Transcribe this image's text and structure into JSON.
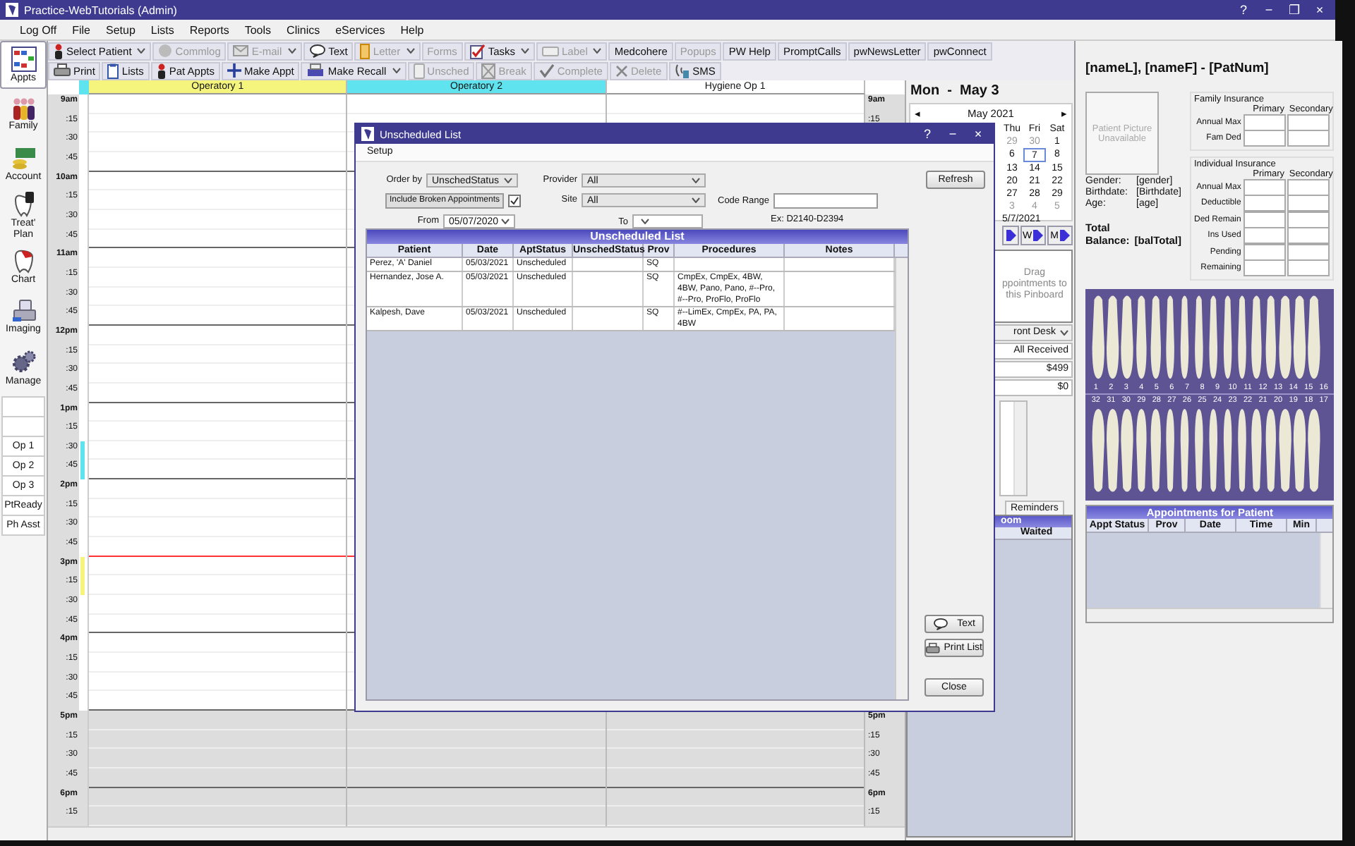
{
  "window": {
    "title": "Practice-WebTutorials (Admin)",
    "controls": [
      "?",
      "−",
      "❐",
      "×"
    ]
  },
  "menu": [
    "Log Off",
    "File",
    "Setup",
    "Lists",
    "Reports",
    "Tools",
    "Clinics",
    "eServices",
    "Help"
  ],
  "toolbar_rows": [
    [
      {
        "label": "Select Patient",
        "kind": "patient",
        "dropdown": true,
        "disabled": false
      },
      {
        "label": "Commlog",
        "kind": "commlog",
        "dropdown": false,
        "disabled": true
      },
      {
        "label": "E-mail",
        "kind": "email",
        "dropdown": true,
        "disabled": true
      },
      {
        "label": "Text",
        "kind": "text",
        "dropdown": false,
        "disabled": false
      },
      {
        "label": "Letter",
        "kind": "letter",
        "dropdown": true,
        "disabled": true
      },
      {
        "label": "Forms",
        "kind": "plain",
        "dropdown": false,
        "disabled": true
      },
      {
        "label": "Tasks",
        "kind": "tasks",
        "dropdown": true,
        "disabled": false
      },
      {
        "label": "Label",
        "kind": "label",
        "dropdown": true,
        "disabled": true
      },
      {
        "label": "Medcohere",
        "kind": "plain",
        "dropdown": false,
        "disabled": false
      },
      {
        "label": "Popups",
        "kind": "plain",
        "dropdown": false,
        "disabled": true
      },
      {
        "label": "PW Help",
        "kind": "plain",
        "dropdown": false,
        "disabled": false
      },
      {
        "label": "PromptCalls",
        "kind": "plain",
        "dropdown": false,
        "disabled": false
      },
      {
        "label": "pwNewsLetter",
        "kind": "plain",
        "dropdown": false,
        "disabled": false
      },
      {
        "label": "pwConnect",
        "kind": "plain",
        "dropdown": false,
        "disabled": false
      }
    ],
    [
      {
        "label": "Print",
        "kind": "print",
        "dropdown": false,
        "disabled": false
      },
      {
        "label": "Lists",
        "kind": "lists",
        "dropdown": false,
        "disabled": false
      },
      {
        "label": "Pat Appts",
        "kind": "patient",
        "dropdown": false,
        "disabled": false
      },
      {
        "label": "Make Appt",
        "kind": "plus",
        "dropdown": false,
        "disabled": false
      },
      {
        "label": "Make Recall",
        "kind": "recall",
        "dropdown": true,
        "disabled": false
      },
      {
        "label": "Unsched",
        "kind": "unsched",
        "dropdown": false,
        "disabled": true
      },
      {
        "label": "Break",
        "kind": "break",
        "dropdown": false,
        "disabled": true
      },
      {
        "label": "Complete",
        "kind": "check",
        "dropdown": false,
        "disabled": true
      },
      {
        "label": "Delete",
        "kind": "delete",
        "dropdown": false,
        "disabled": true
      },
      {
        "label": "SMS",
        "kind": "sms",
        "dropdown": false,
        "disabled": false
      }
    ]
  ],
  "nav": [
    {
      "label": "Appts",
      "kind": "appts",
      "selected": true
    },
    {
      "label": "Family",
      "kind": "family",
      "selected": false
    },
    {
      "label": "Account",
      "kind": "account",
      "selected": false
    },
    {
      "label": "Treat' Plan",
      "kind": "treat",
      "selected": false
    },
    {
      "label": "Chart",
      "kind": "chart",
      "selected": false
    },
    {
      "label": "Imaging",
      "kind": "imaging",
      "selected": false
    },
    {
      "label": "Manage",
      "kind": "manage",
      "selected": false
    }
  ],
  "views": [
    "Op 1",
    "Op 2",
    "Op 3",
    "PtReady",
    "Ph Asst"
  ],
  "schedule": {
    "operatories": [
      {
        "name": "Operatory 1",
        "color": "#f5f57e"
      },
      {
        "name": "Operatory 2",
        "color": "#5fe3ef"
      },
      {
        "name": "Hygiene Op 1",
        "color": "#ffffff"
      }
    ],
    "times": [
      "9am",
      ":15",
      ":30",
      ":45",
      "10am",
      ":15",
      ":30",
      ":45",
      "11am",
      ":15",
      ":30",
      ":45",
      "12pm",
      ":15",
      ":30",
      ":45",
      "1pm",
      ":15",
      ":30",
      ":45",
      "2pm",
      ":15",
      ":30",
      ":45",
      "3pm",
      ":15",
      ":30",
      ":45",
      "4pm",
      ":15",
      ":30",
      ":45",
      "5pm",
      ":15",
      ":30",
      ":45",
      "6pm",
      ":15"
    ],
    "right_times_top": [
      "9am",
      ":15"
    ],
    "right_times_bottom": [
      "5pm",
      ":15",
      ":30",
      ":45",
      "6pm",
      ":15"
    ]
  },
  "day_header": "Mon  -  May 3",
  "calendar": {
    "prev": "◂",
    "month": "May 2021",
    "next": "▸",
    "weekdays": [
      "Thu",
      "Fri",
      "Sat"
    ],
    "weeks": [
      [
        {
          "day": "29",
          "other_month": true,
          "selected": false
        },
        {
          "day": "30",
          "other_month": true,
          "selected": false
        },
        {
          "day": "1",
          "other_month": false,
          "selected": false
        }
      ],
      [
        {
          "day": "6",
          "other_month": false,
          "selected": false
        },
        {
          "day": "7",
          "other_month": false,
          "selected": true
        },
        {
          "day": "8",
          "other_month": false,
          "selected": false
        }
      ],
      [
        {
          "day": "13",
          "other_month": false,
          "selected": false
        },
        {
          "day": "14",
          "other_month": false,
          "selected": false
        },
        {
          "day": "15",
          "other_month": false,
          "selected": false
        }
      ],
      [
        {
          "day": "20",
          "other_month": false,
          "selected": false
        },
        {
          "day": "21",
          "other_month": false,
          "selected": false
        },
        {
          "day": "22",
          "other_month": false,
          "selected": false
        }
      ],
      [
        {
          "day": "27",
          "other_month": false,
          "selected": false
        },
        {
          "day": "28",
          "other_month": false,
          "selected": false
        },
        {
          "day": "29",
          "other_month": false,
          "selected": false
        }
      ],
      [
        {
          "day": "3",
          "other_month": true,
          "selected": false
        },
        {
          "day": "4",
          "other_month": true,
          "selected": false
        },
        {
          "day": "5",
          "other_month": true,
          "selected": false
        }
      ]
    ],
    "date": "5/7/2021"
  },
  "period_buttons": [
    "W",
    "M"
  ],
  "pinboard": [
    "Drag",
    "ppointments to",
    "this Pinboard"
  ],
  "front_desk": {
    "value": "ront Desk"
  },
  "summary": [
    "All Received",
    "$499",
    "$0"
  ],
  "reminders_tab": "Reminders",
  "waiting_room": {
    "title": "oom",
    "columns": [
      "Waited"
    ]
  },
  "patient": {
    "name": "[nameL], [nameF] - [PatNum]",
    "picture": "Patient Picture Unavailable",
    "fields": [
      {
        "label": "Gender:",
        "value": "[gender]"
      },
      {
        "label": "Birthdate:",
        "value": "[Birthdate]"
      },
      {
        "label": "Age:",
        "value": "[age]"
      }
    ],
    "total_label": "Total",
    "balance_label": "Balance:",
    "balance": "[balTotal]"
  },
  "family_insurance": {
    "title": "Family Insurance",
    "columns": [
      "Primary",
      "Secondary"
    ],
    "rows": [
      "Annual Max",
      "Fam Ded"
    ]
  },
  "individual_insurance": {
    "title": "Individual Insurance",
    "columns": [
      "Primary",
      "Secondary"
    ],
    "rows": [
      "Annual Max",
      "Deductible",
      "Ded Remain",
      "Ins Used",
      "Pending",
      "Remaining"
    ]
  },
  "tooth_numbers": {
    "upper": [
      "1",
      "2",
      "3",
      "4",
      "5",
      "6",
      "7",
      "8",
      "9",
      "10",
      "11",
      "12",
      "13",
      "14",
      "15",
      "16"
    ],
    "lower": [
      "32",
      "31",
      "30",
      "29",
      "28",
      "27",
      "26",
      "25",
      "24",
      "23",
      "22",
      "21",
      "20",
      "19",
      "18",
      "17"
    ]
  },
  "patient_appointments": {
    "title": "Appointments for Patient",
    "columns": [
      "Appt Status",
      "Prov",
      "Date",
      "Time",
      "Min"
    ]
  },
  "dialog": {
    "title": "Unscheduled List",
    "controls": [
      "?",
      "−",
      "×"
    ],
    "menu": [
      "Setup"
    ],
    "order_by": {
      "label": "Order by",
      "value": "UnschedStatus"
    },
    "provider": {
      "label": "Provider",
      "value": "All"
    },
    "site": {
      "label": "Site",
      "value": "All"
    },
    "include_broken": {
      "label": "Include Broken Appointments",
      "checked": true
    },
    "code_range": {
      "label": "Code Range",
      "example": "Ex: D2140-D2394"
    },
    "from": {
      "label": "From",
      "value": "05/07/2020"
    },
    "to": {
      "label": "To"
    },
    "grid": {
      "title": "Unscheduled List",
      "columns": [
        "Patient",
        "Date",
        "AptStatus",
        "UnschedStatus",
        "Prov",
        "Procedures",
        "Notes"
      ],
      "rows": [
        {
          "patient": "Perez, 'A' Daniel",
          "date": "05/03/2021",
          "apt_status": "Unscheduled",
          "prov": "SQ"
        },
        {
          "patient": "Hernandez, Jose A.",
          "date": "05/03/2021",
          "apt_status": "Unscheduled",
          "prov": "SQ",
          "procedures": "CmpEx, CmpEx, 4BW, 4BW, Pano, Pano, #--Pro, #--Pro, ProFlo, ProFlo"
        },
        {
          "patient": "Kalpesh, Dave",
          "date": "05/03/2021",
          "apt_status": "Unscheduled",
          "prov": "SQ",
          "procedures": "#--LimEx, CmpEx, PA, PA, 4BW"
        }
      ]
    },
    "buttons": [
      {
        "label": "Refresh",
        "kind": "refresh"
      },
      {
        "label": "Text",
        "kind": "text"
      },
      {
        "label": "Print List",
        "kind": "print"
      },
      {
        "label": "Close",
        "kind": "close"
      }
    ]
  }
}
